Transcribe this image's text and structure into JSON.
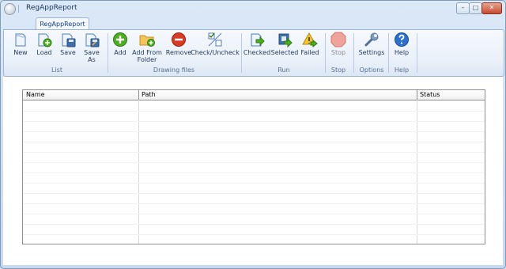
{
  "window": {
    "title": "RegAppReport",
    "minimize": "–",
    "maximize": "□",
    "close": "✕"
  },
  "ribbon": {
    "tab": "RegAppReport",
    "groups": {
      "list": "List",
      "drawing_files": "Drawing files",
      "run": "Run",
      "stop": "Stop",
      "options": "Options",
      "help": "Help"
    },
    "buttons": {
      "new": "New",
      "load": "Load",
      "save": "Save",
      "save_as_1": "Save",
      "save_as_2": "As",
      "add": "Add",
      "add_folder_1": "Add From",
      "add_folder_2": "Folder",
      "remove": "Remove",
      "check_uncheck": "Check/Uncheck",
      "checked": "Checked",
      "selected": "Selected",
      "failed": "Failed",
      "stop": "Stop",
      "settings": "Settings",
      "help": "Help"
    },
    "icons": {
      "new": "document-icon",
      "load": "document-load-icon",
      "save": "document-save-icon",
      "save_as": "document-saveas-icon",
      "add": "plus-circle-icon",
      "add_folder": "folder-add-icon",
      "remove": "minus-circle-icon",
      "check_uncheck": "checkbox-toggle-icon",
      "checked": "run-checked-icon",
      "selected": "run-selected-icon",
      "failed": "run-failed-icon",
      "stop": "stop-sign-icon",
      "settings": "wrench-icon",
      "help": "question-circle-icon"
    }
  },
  "grid": {
    "columns": [
      "Name",
      "Path",
      "Status"
    ],
    "rows": []
  },
  "colors": {
    "accent": "#15428b",
    "add": "#4caf1f",
    "remove": "#d93a22",
    "help": "#2a6fd1"
  }
}
